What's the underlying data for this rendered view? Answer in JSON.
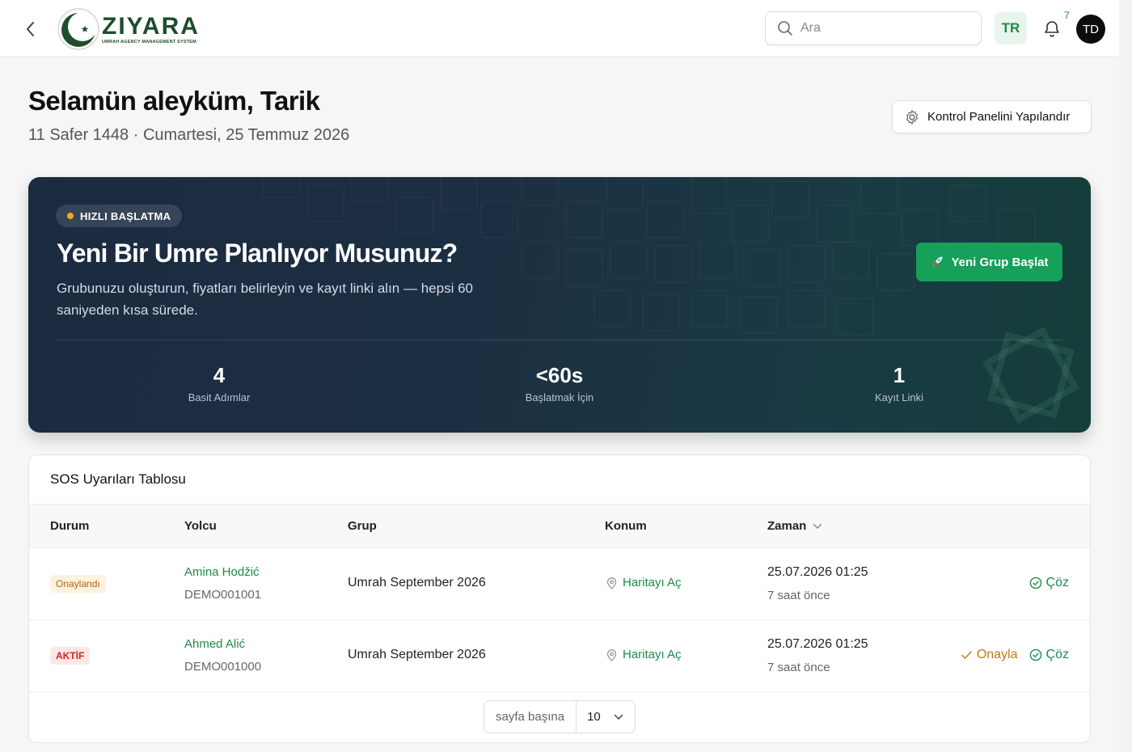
{
  "header": {
    "brand_name": "ZIYARA",
    "brand_tagline": "UMRAH AGENCY MANAGEMENT SYSTEM",
    "search_placeholder": "Ara",
    "language": "TR",
    "notification_count": "7",
    "avatar_initials": "TD"
  },
  "welcome": {
    "greeting": "Selamün aleyküm, Tarik",
    "date": "11 Safer 1448 · Cumartesi, 25 Temmuz 2026",
    "configure_label": "Kontrol Panelini Yapılandır"
  },
  "hero": {
    "badge": "HIZLI BAŞLATMA",
    "title": "Yeni Bir Umre Planlıyor Musunuz?",
    "description": "Grubunuzu oluşturun, fiyatları belirleyin ve kayıt linki alın — hepsi 60 saniyeden kısa sürede.",
    "cta_label": "Yeni Grup Başlat",
    "stats": [
      {
        "value": "4",
        "label": "Basit Adımlar"
      },
      {
        "value": "<60s",
        "label": "Başlatmak İçin"
      },
      {
        "value": "1",
        "label": "Kayıt Linki"
      }
    ]
  },
  "sos_table": {
    "title": "SOS Uyarıları Tablosu",
    "columns": {
      "status": "Durum",
      "passenger": "Yolcu",
      "group": "Grup",
      "location": "Konum",
      "time": "Zaman"
    },
    "rows": [
      {
        "status": "Onaylandı",
        "name": "Amina Hodžić",
        "id": "DEMO001001",
        "group": "Umrah September 2026",
        "location": "Haritayı Aç",
        "datetime": "25.07.2026 01:25",
        "relative": "7 saat önce",
        "approve": "",
        "resolve": "Çöz"
      },
      {
        "status": "AKTİF",
        "name": "Ahmed Alić",
        "id": "DEMO001000",
        "group": "Umrah September 2026",
        "location": "Haritayı Aç",
        "datetime": "25.07.2026 01:25",
        "relative": "7 saat önce",
        "approve": "Onayla",
        "resolve": "Çöz"
      }
    ],
    "pagination": {
      "label": "sayfa başına",
      "page_size": "10"
    }
  },
  "colors": {
    "brand_green": "#1e8a4c",
    "cta_green": "#16a05a",
    "hero_dark": "#1b2b40",
    "warning_orange": "#c07a10",
    "danger_red": "#d42525"
  }
}
